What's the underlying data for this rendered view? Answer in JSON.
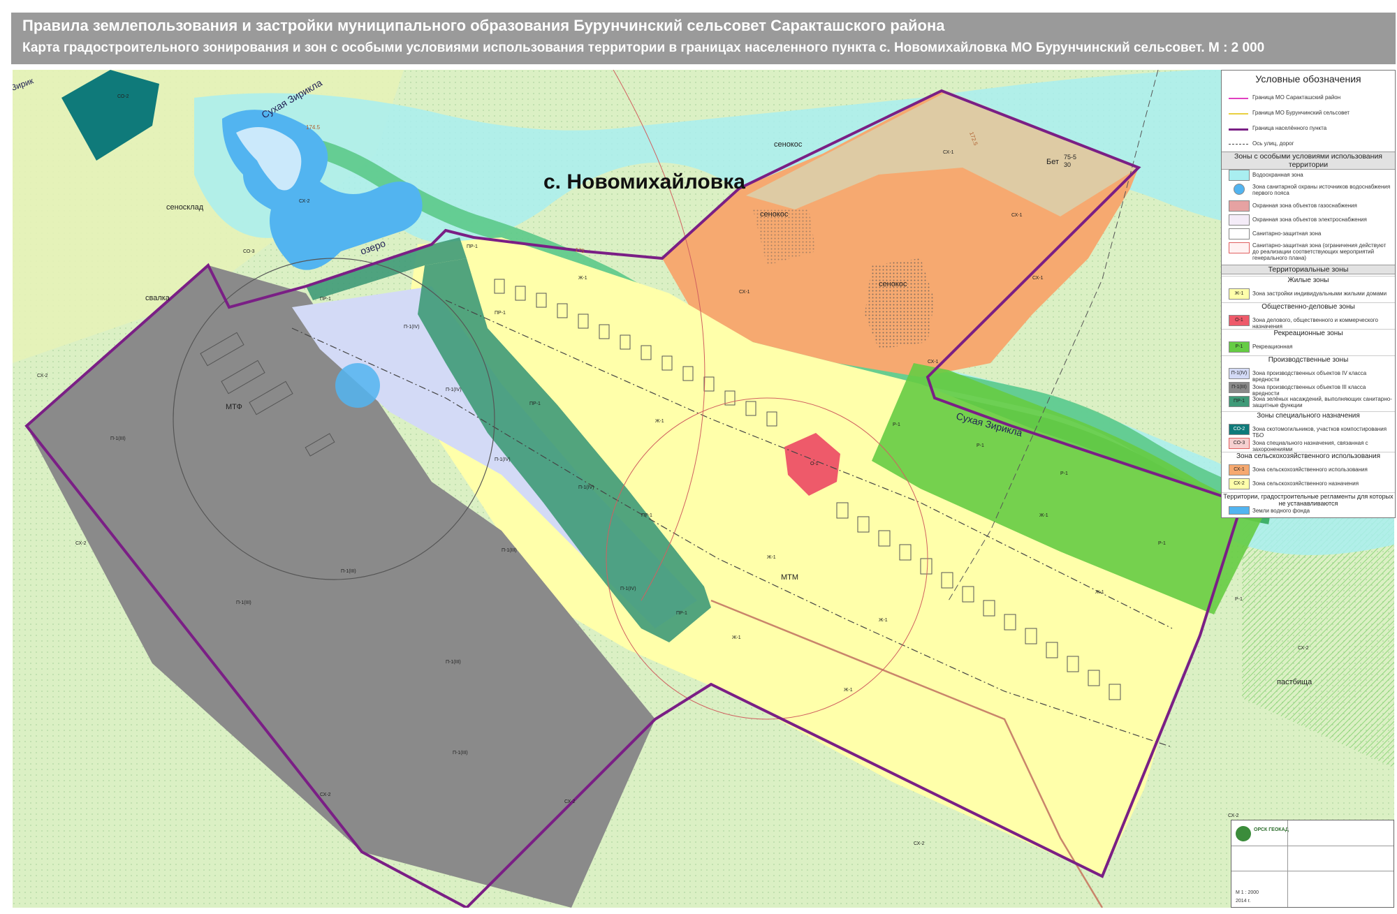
{
  "header": {
    "title": "Правила землепользования и застройки муниципального образования Бурунчинский сельсовет Саракташского района",
    "subtitle": "Карта градостроительного зонирования и зон с особыми условиями использования территории в границах населенного пункта с. Новомихайловка МО Бурунчинский сельсовет. М : 2 000"
  },
  "map": {
    "settlement": "с. Новомихайловка",
    "river_top": "Сухая Зирикла",
    "river_right": "Сухая Зирикла",
    "river_corner": "Зирик",
    "lake": "озеро",
    "labels": {
      "senokos": "сенокос",
      "senosklad": "сеносклад",
      "svalka": "свалка",
      "mtf": "МТФ",
      "mtm": "МТМ",
      "pastbishcha": "пастбища",
      "bet": "Бет",
      "bet_num1": "75-5",
      "bet_num2": "30",
      "h1": "172.5",
      "h2": "175",
      "h3": "174.5"
    },
    "zone_codes": {
      "sx1": "СХ-1",
      "sx2": "СХ-2",
      "zh1": "Ж-1",
      "p1": "П-1(IV)",
      "p1iii": "П-1(III)",
      "pr1": "ПР-1",
      "r1": "Р-1",
      "o1": "О-1",
      "so2": "СО-2",
      "so3": "СО-3"
    },
    "colors": {
      "agri_green": "#c9ecb2",
      "agri_yellow_green": "#e2f0b0",
      "residential": "#ffffaa",
      "hay_orange": "#f6a970",
      "production_grey": "#8a8a8a",
      "production_blue": "#d3daf6",
      "protect_green": "#3f9a78",
      "recreation": "#66cc44",
      "water_zone": "#a9eef0",
      "water": "#52b4f0",
      "public": "#ee5a6a",
      "boundary": "#7a1f85",
      "pasture_hatch": "#9ed98c"
    }
  },
  "legend": {
    "title": "Условные обозначения",
    "lines": [
      {
        "label": "Граница МО Саракташский район",
        "color": "#e040c0"
      },
      {
        "label": "Граница МО Бурунчинский сельсовет",
        "color": "#e8d040"
      },
      {
        "label": "Граница населённого пункта",
        "color": "#7a1f85"
      },
      {
        "label": "Ось улиц, дорог",
        "color": "#444444"
      }
    ],
    "sec_special": "Зоны с особыми условиями использования территории",
    "special": [
      {
        "label": "Водоохранная зона",
        "color": "#a9eef0"
      },
      {
        "label": "Зона санитарной охраны источников водоснабжения первого пояса",
        "color": "#52b4f0"
      },
      {
        "label": "Охранная зона объектов газоснабжения",
        "color": "#e6a2a2"
      },
      {
        "label": "Охранная зона объектов электроснабжения",
        "color": "#f4ecf8"
      },
      {
        "label": "Санитарно-защитная зона",
        "color": "#ffffff"
      },
      {
        "label": "Санитарно-защитная зона (ограничения действуют до реализации соответствующих мероприятий генерального плана)",
        "color": "#fff2f2"
      }
    ],
    "sec_territorial": "Территориальные зоны",
    "sub_res": "Жилые зоны",
    "res": {
      "code": "Ж-1",
      "label": "Зона застройки индивидуальными жилыми домами",
      "color": "#ffffaa"
    },
    "sub_pub": "Общественно-деловые зоны",
    "pub": {
      "code": "О-1",
      "label": "Зона делового, общественного и коммерческого назначения",
      "color": "#ee5a6a"
    },
    "sub_rec": "Рекреационные зоны",
    "rec": {
      "code": "Р-1",
      "label": "Рекреационная",
      "color": "#66cc44"
    },
    "sub_prod": "Производственные зоны",
    "prod": [
      {
        "code": "П-1(IV)",
        "label": "Зона производственных объектов IV класса вредности",
        "color": "#d3daf6"
      },
      {
        "code": "П-1(III)",
        "label": "Зона производственных объектов III класса вредности",
        "color": "#8a8a8a"
      },
      {
        "code": "ПР-1",
        "label": "Зона зелёных насаждений, выполняющих санитарно-защитные функции",
        "color": "#3f9a78"
      }
    ],
    "sub_spec": "Зоны специального назначения",
    "spec": [
      {
        "code": "СО-2",
        "label": "Зона скотомогильников, участков компостирования ТБО",
        "color": "#0f7a7a"
      },
      {
        "code": "СО-3",
        "label": "Зона специального назначения, связанная с захоронениями",
        "color": "#f6d0d0"
      }
    ],
    "sub_agri": "Зона сельскохозяйственного использования",
    "agri": [
      {
        "code": "СХ-1",
        "label": "Зона сельскохозяйственного использования",
        "color": "#f6a970"
      },
      {
        "code": "СХ-2",
        "label": "Зона сельскохозяйственного назначения",
        "color": "#ffffaa"
      }
    ],
    "sub_nonreg": "Территории, градостроительные регламенты для которых не устанавливаются",
    "water": {
      "label": "Земли водного фонда",
      "color": "#52b4f0"
    }
  },
  "titleblock": {
    "org": "ОРСК ГЕОКАД",
    "scale": "М 1 : 2000",
    "year": "2014 г."
  }
}
